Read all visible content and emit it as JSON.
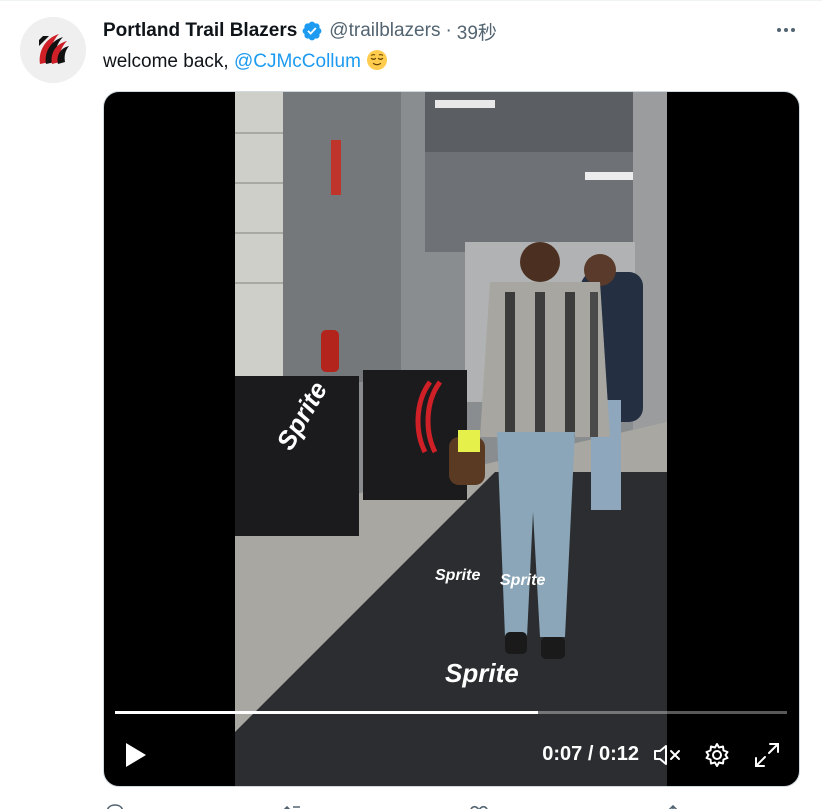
{
  "tweet": {
    "author_name": "Portland Trail Blazers",
    "handle": "@trailblazers",
    "separator": "·",
    "time": "39秒",
    "text_prefix": "welcome back, ",
    "mention": "@CJMcCollum",
    "emoji": "relieved-face",
    "more_icon": "ellipsis-icon",
    "verified_icon": "verified-badge-icon",
    "verified_color": "#1d9bf0",
    "link_color": "#1d9bf0"
  },
  "video": {
    "current_time": "0:07",
    "duration": "0:12",
    "time_text": "0:07 / 0:12",
    "progress": 0.63,
    "controls": [
      "play-icon",
      "mute-icon",
      "settings-gear-icon",
      "fullscreen-icon"
    ],
    "overlay_text": [
      "Sprite",
      "Sprite",
      "Sprite",
      "Sprite"
    ]
  }
}
